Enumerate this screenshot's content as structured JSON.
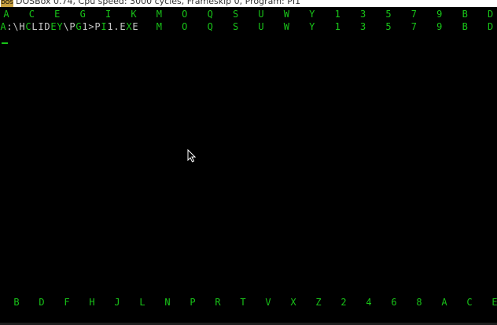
{
  "window": {
    "title": "DOSBox 0.74, Cpu speed:     3000 cycles, Frameskip  0, Program:  PI1"
  },
  "row1": {
    "cells": [
      "A",
      "C",
      "E",
      "G",
      "I",
      "K",
      "M",
      "O",
      "Q",
      "S",
      "U",
      "W",
      "Y",
      "1",
      "3",
      "5",
      "7",
      "9",
      "B",
      "D"
    ]
  },
  "prompt_row": {
    "prompt": [
      "A",
      ":",
      "\\",
      "H",
      "C",
      "L",
      "I",
      "D",
      "E",
      "Y",
      "\\",
      "P",
      "G",
      "1",
      ">",
      "P",
      "I",
      "1",
      ".",
      "E",
      "X",
      "E"
    ],
    "prompt_colors": [
      "g",
      "w",
      "w",
      "w",
      "g",
      "w",
      "w",
      "w",
      "g",
      "g",
      "w",
      "w",
      "g",
      "w",
      "w",
      "w",
      "g",
      "w",
      "w",
      "w",
      "g",
      "w"
    ],
    "tail": [
      "M",
      "O",
      "Q",
      "S",
      "U",
      "W",
      "Y",
      "1",
      "3",
      "5",
      "7",
      "9",
      "B",
      "D"
    ]
  },
  "bottom_row": {
    "cells": [
      "B",
      "D",
      "F",
      "H",
      "J",
      "L",
      "N",
      "P",
      "R",
      "T",
      "V",
      "X",
      "Z",
      "2",
      "4",
      "6",
      "8",
      "A",
      "C",
      "E"
    ]
  },
  "colors": {
    "green": "#18c418",
    "white": "#c8c8c8",
    "background": "#000000"
  },
  "icons": {
    "app": "dosbox-icon",
    "pointer": "arrow-pointer-icon"
  }
}
